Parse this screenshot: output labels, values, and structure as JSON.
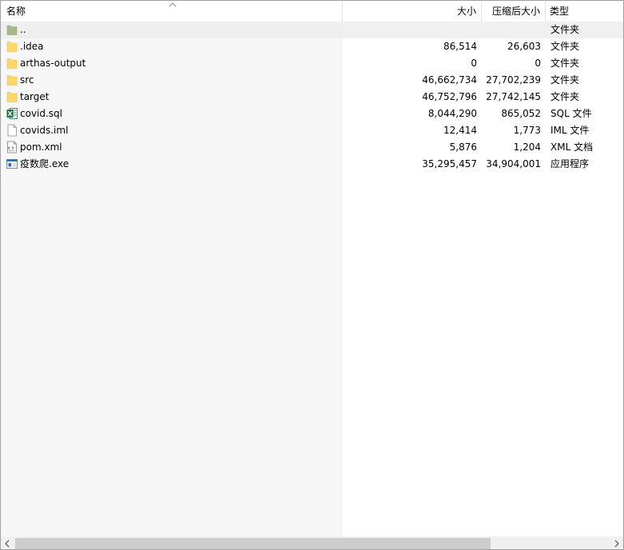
{
  "header": {
    "name": "名称",
    "size": "大小",
    "packed": "压缩后大小",
    "type": "类型"
  },
  "rows": [
    {
      "name": "..",
      "size": "",
      "packed": "",
      "type": "文件夹",
      "icon": "parent-folder-icon"
    },
    {
      "name": ".idea",
      "size": "86,514",
      "packed": "26,603",
      "type": "文件夹",
      "icon": "folder-icon"
    },
    {
      "name": "arthas-output",
      "size": "0",
      "packed": "0",
      "type": "文件夹",
      "icon": "folder-icon"
    },
    {
      "name": "src",
      "size": "46,662,734",
      "packed": "27,702,239",
      "type": "文件夹",
      "icon": "folder-icon"
    },
    {
      "name": "target",
      "size": "46,752,796",
      "packed": "27,742,145",
      "type": "文件夹",
      "icon": "folder-icon"
    },
    {
      "name": "covid.sql",
      "size": "8,044,290",
      "packed": "865,052",
      "type": "SQL 文件",
      "icon": "excel-file-icon"
    },
    {
      "name": "covids.iml",
      "size": "12,414",
      "packed": "1,773",
      "type": "IML 文件",
      "icon": "blank-file-icon"
    },
    {
      "name": "pom.xml",
      "size": "5,876",
      "packed": "1,204",
      "type": "XML 文档",
      "icon": "xml-file-icon"
    },
    {
      "name": "疫数爬.exe",
      "size": "35,295,457",
      "packed": "34,904,001",
      "type": "应用程序",
      "icon": "exe-file-icon"
    }
  ],
  "colors": {
    "folder": "#ffd766",
    "selected_row": "#f0f0f0",
    "excel": "#1e7145"
  },
  "scrollbar": {
    "horizontal_position": 0,
    "visible_fraction": 0.8
  }
}
